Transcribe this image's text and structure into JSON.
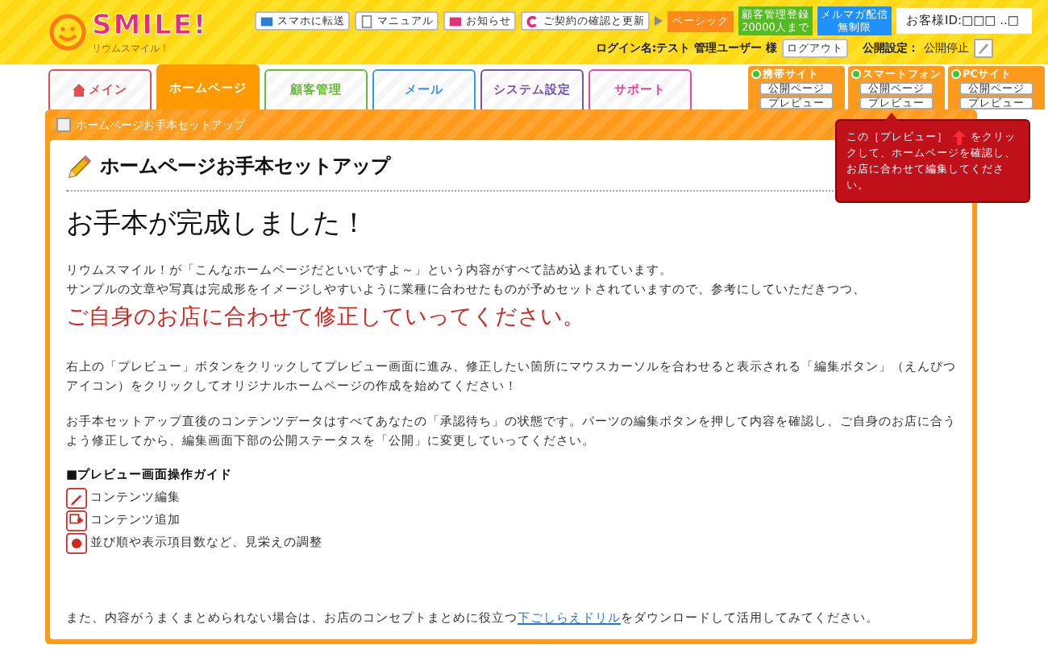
{
  "header": {
    "logo": "SMILE!",
    "logo_sub": "リウムスマイル！",
    "top_links": [
      "スマホに転送",
      "マニュアル",
      "お知らせ",
      "ご契約の確認と更新"
    ],
    "plan": "ベーシック",
    "badges": [
      {
        "lines": [
          "顧客管理登録",
          "20000人まで"
        ],
        "color": "#55bb22"
      },
      {
        "lines": [
          "メルマガ配信",
          "無制限"
        ],
        "color": "#1e90ff"
      }
    ],
    "customer_id": "お客様ID:□□□ ..□",
    "login": "ログイン名:テスト 管理ユーザー 様",
    "logout": "ログアウト",
    "publish_label": "公開設定：",
    "publish_value": "公開停止"
  },
  "tabs": [
    {
      "label": "メイン",
      "selected": false,
      "color": "#e05050"
    },
    {
      "label": "ホームページ",
      "selected": true,
      "color": "#ff9900"
    },
    {
      "label": "顧客管理",
      "selected": false,
      "color": "#66bb33"
    },
    {
      "label": "メール",
      "selected": false,
      "color": "#3399ee"
    },
    {
      "label": "システム設定",
      "selected": false,
      "color": "#7755aa"
    },
    {
      "label": "サポート",
      "selected": false,
      "color": "#ee4499"
    }
  ],
  "sites": [
    {
      "name": "携帯サイト",
      "on": true,
      "buttons": [
        "公開ページ",
        "プレビュー"
      ]
    },
    {
      "name": "スマートフォン",
      "on": true,
      "buttons": [
        "公開ページ",
        "プレビュー"
      ]
    },
    {
      "name": "PCサイト",
      "on": true,
      "buttons": [
        "公開ページ",
        "プレビュー"
      ]
    }
  ],
  "tooltip": {
    "before": "この［プレビュー］",
    "after": "をクリックして、ホームページを確認し、お店に合わせて編集してください。"
  },
  "breadcrumb": "ホームページお手本セットアップ",
  "title": "ホームページお手本セットアップ",
  "heading": "お手本が完成しました！",
  "paragraphs": [
    {
      "kind": "text",
      "lines": [
        "リウムスマイル！が「こんなホームページだといいですよ～」という内容がすべて詰め込まれています。",
        "サンプルの文章や写真は完成形をイメージしやすいように業種に合わせたものが予めセットされていますので、参考にしていただきつつ、"
      ]
    },
    {
      "kind": "emphasis",
      "lines": [
        "ご自身のお店に合わせて修正していってください。"
      ]
    },
    {
      "kind": "text",
      "lines": [
        "右上の「プレビュー」ボタンをクリックしてプレビュー画面に進み、修正したい箇所にマウスカーソルを合わせると表示される「編集ボタン」（えんぴつアイコン）をクリックしてオリジナルホームページの作成を始めてください！"
      ]
    },
    {
      "kind": "text",
      "lines": [
        "お手本セットアップ直後のコンテンツデータはすべてあなたの「承認待ち」の状態です。パーツの編集ボタンを押して内容を確認し、ご自身のお店に合うよう修正してから、編集画面下部の公開ステータスを「公開」に変更していってください。"
      ]
    }
  ],
  "guide": {
    "title": "■プレビュー画面操作ガイド",
    "items": [
      {
        "kind": "edit",
        "label": "コンテンツ編集"
      },
      {
        "kind": "add",
        "label": "コンテンツ追加"
      },
      {
        "kind": "adjust",
        "label": "並び順や表示項目数など、見栄えの調整"
      }
    ]
  },
  "footer": {
    "before": "また、内容がうまくまとめられない場合は、お店のコンセプトまとめに役立つ",
    "link": "下ごしらえドリル",
    "after": "をダウンロードして活用してみてください。"
  }
}
